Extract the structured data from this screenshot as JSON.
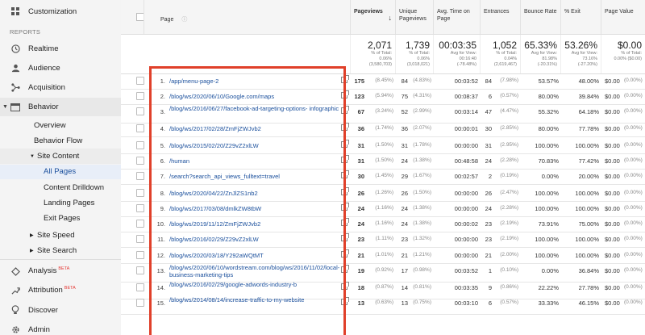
{
  "sidebar": {
    "customization": "Customization",
    "section_reports": "REPORTS",
    "realtime": "Realtime",
    "audience": "Audience",
    "acquisition": "Acquisition",
    "behavior": "Behavior",
    "overview": "Overview",
    "behavior_flow": "Behavior Flow",
    "site_content": "Site Content",
    "all_pages": "All Pages",
    "content_drilldown": "Content Drilldown",
    "landing_pages": "Landing Pages",
    "exit_pages": "Exit Pages",
    "site_speed": "Site Speed",
    "site_search": "Site Search",
    "analysis": "Analysis",
    "analysis_badge": "BETA",
    "attribution": "Attribution",
    "attribution_badge": "BETA",
    "discover": "Discover",
    "admin": "Admin"
  },
  "table": {
    "headers": {
      "page": "Page",
      "pageviews": "Pageviews",
      "unique": "Unique Pageviews",
      "avg_time": "Avg. Time on Page",
      "entrances": "Entrances",
      "bounce": "Bounce Rate",
      "exit": "% Exit",
      "value": "Page Value"
    },
    "totals": {
      "pageviews": "2,071",
      "pageviews_sub1": "% of Total:",
      "pageviews_sub2": "0.06%",
      "pageviews_sub3": "(3,580,703)",
      "unique": "1,739",
      "unique_sub1": "% of Total:",
      "unique_sub2": "0.06%",
      "unique_sub3": "(3,018,021)",
      "avg_time": "00:03:35",
      "avg_time_sub1": "Avg for View:",
      "avg_time_sub2": "00:16:40",
      "avg_time_sub3": "(-78.48%)",
      "entrances": "1,052",
      "entrances_sub1": "% of Total:",
      "entrances_sub2": "0.04%",
      "entrances_sub3": "(2,619,467)",
      "bounce": "65.33%",
      "bounce_sub1": "Avg for View:",
      "bounce_sub2": "81.98%",
      "bounce_sub3": "(-20.31%)",
      "exit": "53.26%",
      "exit_sub1": "Avg for View:",
      "exit_sub2": "73.16%",
      "exit_sub3": "(-27.20%)",
      "value": "$0.00",
      "value_sub1": "% of Total:",
      "value_sub2": "0.00% ($0.00)",
      "value_sub3": ""
    },
    "rows": [
      {
        "n": "1.",
        "page": "/app/menu-page-2",
        "pv": "175",
        "pvp": "(8.45%)",
        "up": "84",
        "upp": "(4.83%)",
        "t": "00:03:52",
        "en": "84",
        "enp": "(7.98%)",
        "br": "53.57%",
        "ex": "48.00%",
        "val": "$0.00",
        "valp": "(0.00%)"
      },
      {
        "n": "2.",
        "page": "/blog/ws/2020/06/10/Google.com/maps",
        "pv": "123",
        "pvp": "(5.94%)",
        "up": "75",
        "upp": "(4.31%)",
        "t": "00:08:37",
        "en": "6",
        "enp": "(0.57%)",
        "br": "80.00%",
        "ex": "39.84%",
        "val": "$0.00",
        "valp": "(0.00%)"
      },
      {
        "n": "3.",
        "page": "/blog/ws/2016/06/27/facebook-ad-targeting-options- infographic",
        "pv": "67",
        "pvp": "(3.24%)",
        "up": "52",
        "upp": "(2.99%)",
        "t": "00:03:14",
        "en": "47",
        "enp": "(4.47%)",
        "br": "55.32%",
        "ex": "64.18%",
        "val": "$0.00",
        "valp": "(0.00%)"
      },
      {
        "n": "4.",
        "page": "/blog/ws/2017/02/28/ZmFjZWJvb2",
        "pv": "36",
        "pvp": "(1.74%)",
        "up": "36",
        "upp": "(2.07%)",
        "t": "00:00:01",
        "en": "30",
        "enp": "(2.85%)",
        "br": "80.00%",
        "ex": "77.78%",
        "val": "$0.00",
        "valp": "(0.00%)"
      },
      {
        "n": "5.",
        "page": "/blog/ws/2015/02/20/Z29vZ2xlLW",
        "pv": "31",
        "pvp": "(1.50%)",
        "up": "31",
        "upp": "(1.78%)",
        "t": "00:00:00",
        "en": "31",
        "enp": "(2.95%)",
        "br": "100.00%",
        "ex": "100.00%",
        "val": "$0.00",
        "valp": "(0.00%)"
      },
      {
        "n": "6.",
        "page": "/human",
        "pv": "31",
        "pvp": "(1.50%)",
        "up": "24",
        "upp": "(1.38%)",
        "t": "00:48:58",
        "en": "24",
        "enp": "(2.28%)",
        "br": "70.83%",
        "ex": "77.42%",
        "val": "$0.00",
        "valp": "(0.00%)"
      },
      {
        "n": "7.",
        "page": "/search?search_api_views_fulltext=travel",
        "pv": "30",
        "pvp": "(1.45%)",
        "up": "29",
        "upp": "(1.67%)",
        "t": "00:02:57",
        "en": "2",
        "enp": "(0.19%)",
        "br": "0.00%",
        "ex": "20.00%",
        "val": "$0.00",
        "valp": "(0.00%)"
      },
      {
        "n": "8.",
        "page": "/blog/ws/2020/04/22/ZnJlZS1nb2",
        "pv": "26",
        "pvp": "(1.26%)",
        "up": "26",
        "upp": "(1.50%)",
        "t": "00:00:00",
        "en": "26",
        "enp": "(2.47%)",
        "br": "100.00%",
        "ex": "100.00%",
        "val": "$0.00",
        "valp": "(0.00%)"
      },
      {
        "n": "9.",
        "page": "/blog/ws/2017/03/08/dmlkZW8tbW",
        "pv": "24",
        "pvp": "(1.16%)",
        "up": "24",
        "upp": "(1.38%)",
        "t": "00:00:00",
        "en": "24",
        "enp": "(2.28%)",
        "br": "100.00%",
        "ex": "100.00%",
        "val": "$0.00",
        "valp": "(0.00%)"
      },
      {
        "n": "10.",
        "page": "/blog/ws/2019/11/12/ZmFjZWJvb2",
        "pv": "24",
        "pvp": "(1.16%)",
        "up": "24",
        "upp": "(1.38%)",
        "t": "00:00:02",
        "en": "23",
        "enp": "(2.19%)",
        "br": "73.91%",
        "ex": "75.00%",
        "val": "$0.00",
        "valp": "(0.00%)"
      },
      {
        "n": "11.",
        "page": "/blog/ws/2016/02/29/Z29vZ2xlLW",
        "pv": "23",
        "pvp": "(1.11%)",
        "up": "23",
        "upp": "(1.32%)",
        "t": "00:00:00",
        "en": "23",
        "enp": "(2.19%)",
        "br": "100.00%",
        "ex": "100.00%",
        "val": "$0.00",
        "valp": "(0.00%)"
      },
      {
        "n": "12.",
        "page": "/blog/ws/2020/03/18/Y292aWQtMT",
        "pv": "21",
        "pvp": "(1.01%)",
        "up": "21",
        "upp": "(1.21%)",
        "t": "00:00:00",
        "en": "21",
        "enp": "(2.00%)",
        "br": "100.00%",
        "ex": "100.00%",
        "val": "$0.00",
        "valp": "(0.00%)"
      },
      {
        "n": "13.",
        "page": "/blog/ws/2020/06/10/wordstream.com/blog/ws/2016/11/02/local-business-marketing-tips",
        "pv": "19",
        "pvp": "(0.92%)",
        "up": "17",
        "upp": "(0.98%)",
        "t": "00:03:52",
        "en": "1",
        "enp": "(0.10%)",
        "br": "0.00%",
        "ex": "36.84%",
        "val": "$0.00",
        "valp": "(0.00%)"
      },
      {
        "n": "14.",
        "page": "/blog/ws/2016/02/29/google-adwords-industry-b",
        "pv": "18",
        "pvp": "(0.87%)",
        "up": "14",
        "upp": "(0.81%)",
        "t": "00:03:35",
        "en": "9",
        "enp": "(0.86%)",
        "br": "22.22%",
        "ex": "27.78%",
        "val": "$0.00",
        "valp": "(0.00%)"
      },
      {
        "n": "15.",
        "page": "/blog/ws/2014/08/14/increase-traffic-to-my-website",
        "pv": "13",
        "pvp": "(0.63%)",
        "up": "13",
        "upp": "(0.75%)",
        "t": "00:03:10",
        "en": "6",
        "enp": "(0.57%)",
        "br": "33.33%",
        "ex": "46.15%",
        "val": "$0.00",
        "valp": "(0.00%)"
      }
    ]
  },
  "colors": {
    "highlight": "#e0402a",
    "link": "#1a4f9c",
    "sidebar_bg": "#f4f4f4"
  }
}
